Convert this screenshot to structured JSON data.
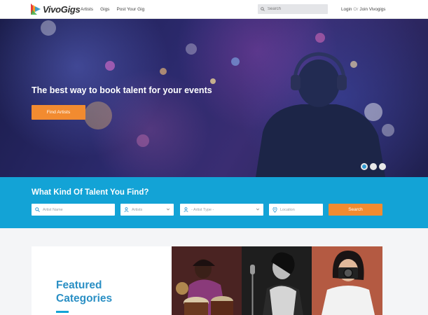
{
  "brand": {
    "name": "VivoGigs"
  },
  "nav": {
    "items": [
      "Artists",
      "Gigs",
      "Post Your Gig"
    ]
  },
  "search": {
    "placeholder": "Search"
  },
  "auth": {
    "login": "Login",
    "or": "Or",
    "join": "Join Vivogigs"
  },
  "hero": {
    "title": "The best way to book talent for your events",
    "cta": "Find Artists",
    "slides": 3,
    "active_slide": 1
  },
  "finder": {
    "title": "What Kind Of Talent You Find?",
    "artist_name_placeholder": "Artist Name",
    "artists_label": "Artists",
    "artist_type_label": "- Artist Type -",
    "location_placeholder": "Location",
    "search_button": "Search"
  },
  "featured": {
    "title_line1": "Featured",
    "title_line2": "Categories"
  },
  "colors": {
    "accent_blue": "#13a3d6",
    "cta_orange": "#f28b30",
    "heading_blue": "#2a8fc4"
  }
}
